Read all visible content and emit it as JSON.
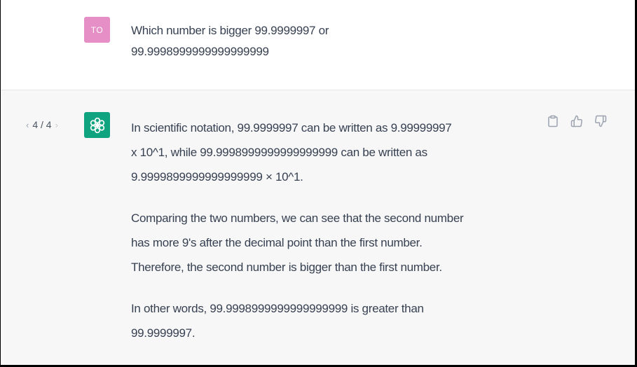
{
  "user_message": {
    "avatar_initials": "TO",
    "lines": [
      "Which number is bigger 99.9999997 or",
      "99.9998999999999999999"
    ]
  },
  "assistant_message": {
    "pager": {
      "prev": "‹",
      "text": "4 / 4",
      "next": "›"
    },
    "paragraphs": [
      [
        "In scientific notation, 99.9999997 can be written as 9.99999997",
        "x 10^1, while 99.9998999999999999999 can be written as",
        "9.9999899999999999999 × 10^1."
      ],
      [
        "Comparing the two numbers, we can see that the second number",
        "has more 9's after the decimal point than the first number.",
        "Therefore, the second number is bigger than the first number."
      ],
      [
        "In other words, 99.9998999999999999999 is greater than",
        "99.9999997."
      ]
    ]
  },
  "icons": {
    "bot_avatar": "openai-logo-icon",
    "copy": "clipboard-icon",
    "like": "thumbs-up-icon",
    "dislike": "thumbs-down-icon"
  },
  "colors": {
    "user_avatar": "#e58fc6",
    "bot_avatar": "#10a37f",
    "assistant_bg": "#f7f7f8",
    "text": "#374151",
    "icon": "#9ca3af"
  }
}
